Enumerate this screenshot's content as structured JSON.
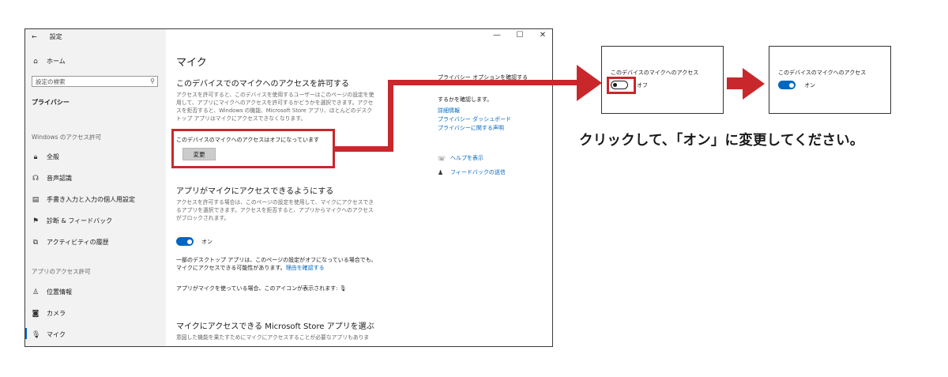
{
  "window": {
    "back_icon": "back-arrow-icon",
    "title": "設定",
    "controls": [
      "—",
      "☐",
      "✕"
    ]
  },
  "sidebar": {
    "home": "ホーム",
    "search_placeholder": "設定の検索",
    "privacy": "プライバシー",
    "section_windows": "Windows のアクセス許可",
    "windows_items": [
      "全般",
      "音声認識",
      "手書き入力と入力の個人用設定",
      "診断 & フィードバック",
      "アクティビティの履歴"
    ],
    "section_apps": "アプリのアクセス許可",
    "app_items": [
      "位置情報",
      "カメラ",
      "マイク"
    ]
  },
  "main": {
    "title": "マイク",
    "h_device": "このデバイスでのマイクへのアクセスを許可する",
    "device_desc": "アクセスを許可すると、このデバイスを使用するユーザーはこのページの設定を使用して、アプリにマイクへのアクセスを許可するかどうかを選択できます。アクセスを拒否すると、Windows の機能、Microsoft Store アプリ、ほとんどのデスクトップ アプリはマイクにアクセスできなくなります。",
    "device_status": "このデバイスのマイクへのアクセスはオフになっています",
    "change_button": "変更",
    "h_apps": "アプリがマイクにアクセスできるようにする",
    "apps_desc": "アクセスを許可する場合は、このページの設定を使用して、マイクにアクセスできるアプリを選択できます。アクセスを拒否すると、アプリからマイクへのアクセスがブロックされます。",
    "toggle_on_label": "オン",
    "desktop_note": "一部のデスクトップ アプリは、このページの設定がオフになっている場合でも、マイクにアクセスできる可能性があります。",
    "reason_link": "理由を確認する",
    "icon_note": "アプリがマイクを使っている場合、このアイコンが表示されます:",
    "h_store": "マイクにアクセスできる Microsoft Store アプリを選ぶ",
    "store_desc": "意図した機能を果たすためにマイクにアクセスすることが必要なアプリもありま"
  },
  "right_column": {
    "privacy_options_title": "プライバシー オプションを確認する",
    "privacy_options_desc": "するかを確認します。",
    "links": [
      "詳細情報",
      "プライバシー ダッシュボード",
      "プライバシーに関する声明"
    ],
    "help": "ヘルプを表示",
    "feedback": "フィードバックの送信"
  },
  "panels": {
    "title": "このデバイスのマイクへのアクセス",
    "off_label": "オフ",
    "on_label": "オン"
  },
  "instruction": "クリックして、「オン」に変更してください。",
  "colors": {
    "accent": "#0067c0",
    "annotation_red": "#c8282b",
    "sidebar_bg": "#f2f2f2"
  }
}
